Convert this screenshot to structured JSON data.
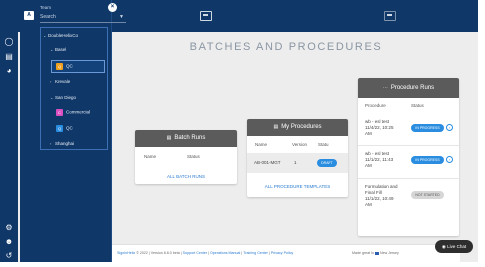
{
  "drawer": {
    "team_label": "Team",
    "avatar": "A",
    "search_placeholder": "Search",
    "tree": [
      {
        "label": "DoubleHelixCo",
        "level": 0
      },
      {
        "label": "Basel",
        "level": 1
      },
      {
        "label": "QC",
        "level": 2,
        "badge": "Q",
        "badge_color": "#f0a020"
      },
      {
        "label": "Krevale",
        "level": 1
      },
      {
        "label": "San Diego",
        "level": 1
      },
      {
        "label": "Commercial",
        "level": 2,
        "badge": "C",
        "badge_color": "#d94fbf"
      },
      {
        "label": "QC",
        "level": 2,
        "badge": "Q",
        "badge_color": "#2a8de0"
      },
      {
        "label": "Shanghai",
        "level": 1
      }
    ]
  },
  "main": {
    "title": "BATCHES AND PROCEDURES",
    "batch_runs": {
      "title": "Batch Runs",
      "cols": [
        "Name",
        "Status"
      ],
      "link": "ALL BATCH RUNS"
    },
    "my_procedures": {
      "title": "My Procedures",
      "cols": [
        "Name",
        "Version",
        "Statu"
      ],
      "row": {
        "name": "AB-001-MGT",
        "version": "1",
        "status": "DRAFT"
      },
      "link": "ALL PROCEDURE TEMPLATES"
    },
    "procedure_runs": {
      "title": "Procedure Runs",
      "cols": [
        "Procedure",
        "Status"
      ],
      "rows": [
        {
          "line1": "wb - esl test",
          "line2": "11/4/22, 10:25",
          "line3": "AM",
          "status": "IN PROGRESS"
        },
        {
          "line1": "wb - esl test",
          "line2": "11/1/22, 11:43",
          "line3": "AM",
          "status": "IN PROGRESS"
        },
        {
          "line1": "Formulation and",
          "line2": "Final Fill",
          "line3": "11/1/22, 10:49",
          "line4": "AM",
          "status": "NOT STARTED"
        }
      ]
    }
  },
  "footer": {
    "brand": "SignInHelix",
    "copy": "© 2022 | Version 8.8.0 beta |",
    "support": "Support Center",
    "sep1": "|",
    "ops": "Operations Manual",
    "sep2": "|",
    "training": "Training Center",
    "sep3": "|",
    "privacy": "Privacy Policy",
    "made": "Made great in",
    "flag": "New Jersey"
  },
  "chat": {
    "label": "Live Chat"
  },
  "colors": {
    "navy": "#0f3768",
    "accent": "#2a8de0",
    "card_head": "#5b5b5b"
  }
}
